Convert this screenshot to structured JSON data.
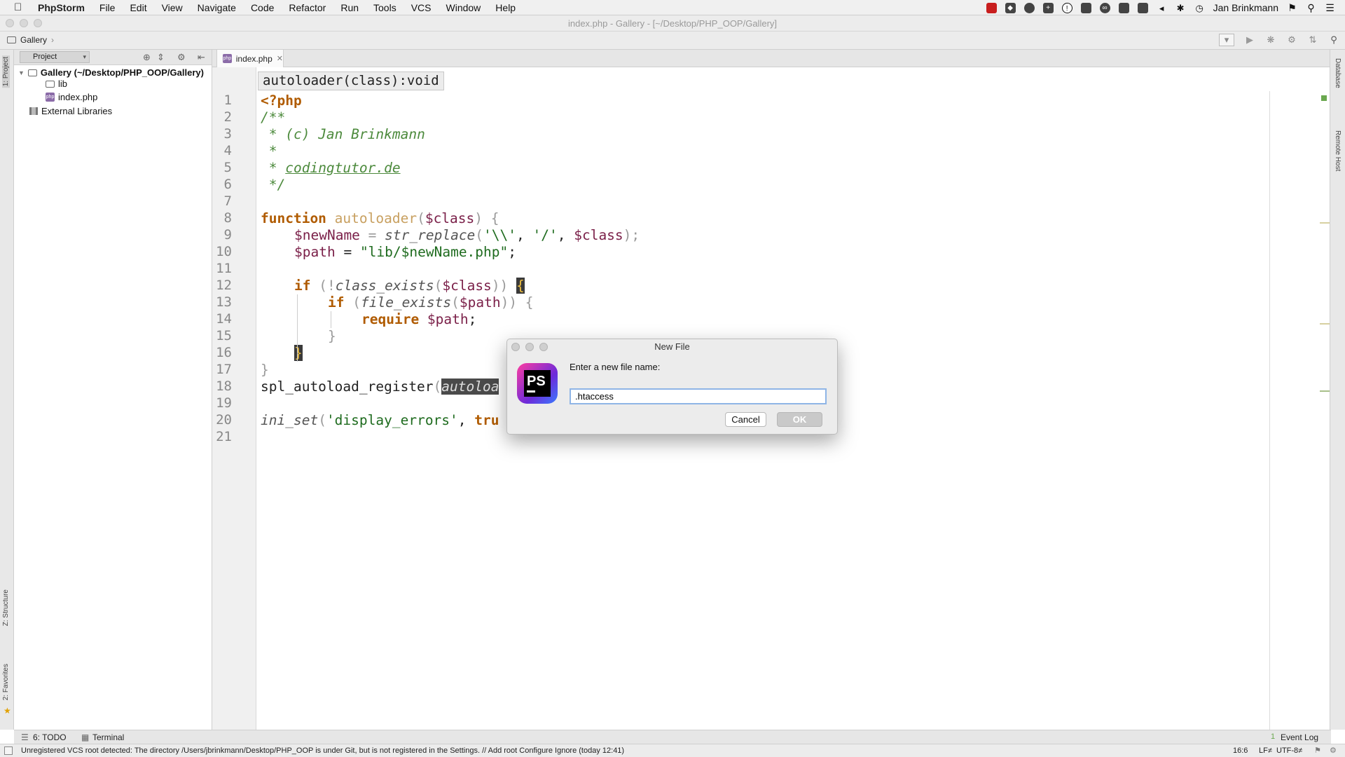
{
  "menubar": {
    "app": "PhpStorm",
    "items": [
      "File",
      "Edit",
      "View",
      "Navigate",
      "Code",
      "Refactor",
      "Run",
      "Tools",
      "VCS",
      "Window",
      "Help"
    ],
    "user": "Jan Brinkmann"
  },
  "window": {
    "title": "index.php - Gallery - [~/Desktop/PHP_OOP/Gallery]"
  },
  "navbar": {
    "breadcrumb": "Gallery"
  },
  "left_stripe": {
    "project": "1: Project",
    "structure": "Z: Structure",
    "favorites": "2: Favorites"
  },
  "right_stripe": {
    "database": "Database",
    "remote_host": "Remote Host"
  },
  "project": {
    "selector": "Project",
    "tree": {
      "root": "Gallery (~/Desktop/PHP_OOP/Gallery)",
      "lib": "lib",
      "index": "index.php",
      "external": "External Libraries"
    }
  },
  "editor": {
    "tab": "index.php",
    "signature": "autoloader(class):void",
    "line_numbers": [
      "1",
      "2",
      "3",
      "4",
      "5",
      "6",
      "7",
      "8",
      "9",
      "10",
      "11",
      "12",
      "13",
      "14",
      "15",
      "16",
      "17",
      "18",
      "19",
      "20",
      "21"
    ],
    "code": {
      "l1": "<?php",
      "l2": "/**",
      "l3a": " * ",
      "l3b": "(c) Jan Brinkmann",
      "l4": " *",
      "l5a": " * ",
      "l5b": "codingtutor.de",
      "l6": " */",
      "l8_kw": "function",
      "l8_fn": "autoloader",
      "l8_p1": "(",
      "l8_var": "$class",
      "l8_p2": ") {",
      "l9_var": "$newName",
      "l9_eq": " = ",
      "l9_fn": "str_replace",
      "l9_p1": "(",
      "l9_s1": "'\\\\'",
      "l9_c1": ", ",
      "l9_s2": "'/'",
      "l9_c2": ", ",
      "l9_var2": "$class",
      "l9_end": ");",
      "l10_var": "$path",
      "l10_eq": " = ",
      "l10_s": "\"lib/$newName.php\"",
      "l10_end": ";",
      "l12_kw": "if",
      "l12_a": " (!",
      "l12_fn": "class_exists",
      "l12_b": "(",
      "l12_var": "$class",
      "l12_c": ")) ",
      "l12_d": "{",
      "l13_kw": "if",
      "l13_a": " (",
      "l13_fn": "file_exists",
      "l13_b": "(",
      "l13_var": "$path",
      "l13_c": ")) {",
      "l14_kw": "require",
      "l14_var": " $path",
      "l14_end": ";",
      "l15": "}",
      "l16": "}",
      "l17": "}",
      "l18_fn": "spl_autoload_register",
      "l18_p": "(",
      "l18_arg": "autoloa",
      "l20_fn": "ini_set",
      "l20_p": "(",
      "l20_s": "'display_errors'",
      "l20_c": ", ",
      "l20_kw": "tru"
    }
  },
  "dialog": {
    "title": "New File",
    "prompt": "Enter a new file name:",
    "value": ".htaccess",
    "cancel": "Cancel",
    "ok": "OK",
    "logo_text": "PS"
  },
  "toolwindows": {
    "todo": "6: TODO",
    "terminal": "Terminal",
    "event_log": "Event Log",
    "event_count": "1"
  },
  "statusbar": {
    "message": "Unregistered VCS root detected: The directory /Users/jbrinkmann/Desktop/PHP_OOP is under Git, but is not registered in the Settings. // Add root  Configure  Ignore (today 12:41)",
    "position": "16:6",
    "line_sep": "LF≠",
    "encoding": "UTF-8≠"
  }
}
